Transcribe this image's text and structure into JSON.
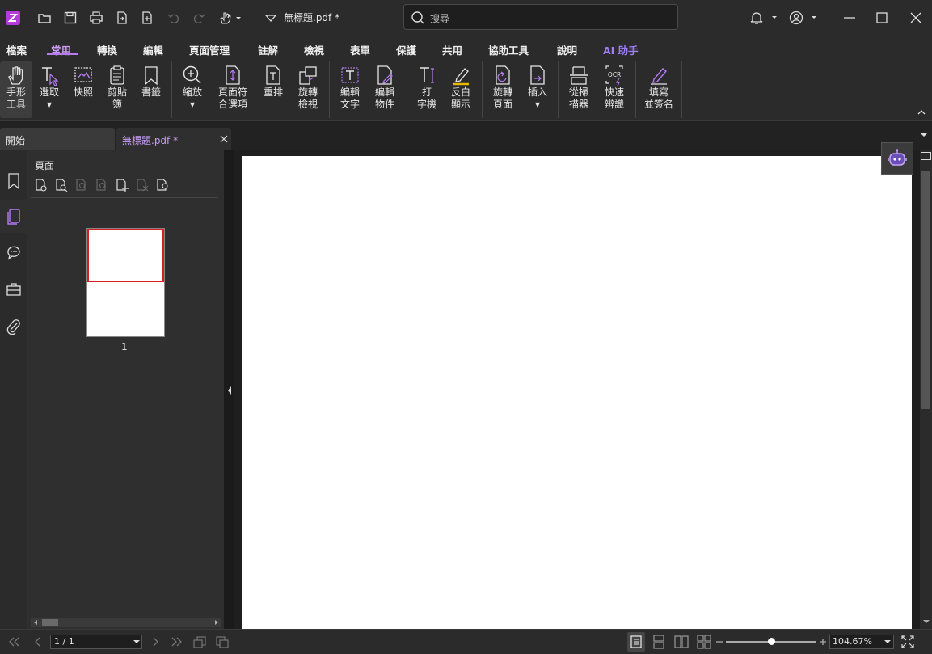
{
  "titlebar": {
    "doc_title": "無標題.pdf *",
    "search_placeholder": "搜尋"
  },
  "menu": {
    "items": [
      "檔案",
      "常用",
      "轉換",
      "編輯",
      "頁面管理",
      "註解",
      "檢視",
      "表單",
      "保護",
      "共用",
      "協助工具",
      "說明",
      "AI 助手"
    ],
    "active": "常用"
  },
  "ribbon": {
    "hand_tool": [
      "手形",
      "工具"
    ],
    "select": [
      "選取"
    ],
    "snapshot": [
      "快照"
    ],
    "clipboard": [
      "剪貼",
      "簿"
    ],
    "bookmark": [
      "書籤"
    ],
    "zoom": [
      "縮放"
    ],
    "fit_page": [
      "頁面符",
      "合選項"
    ],
    "reflow": [
      "重排"
    ],
    "rotate_view": [
      "旋轉",
      "檢視"
    ],
    "edit_text": [
      "編輯",
      "文字"
    ],
    "edit_object": [
      "編輯",
      "物件"
    ],
    "typewriter": [
      "打",
      "字機"
    ],
    "highlight": [
      "反白",
      "顯示"
    ],
    "rotate_page": [
      "旋轉",
      "頁面"
    ],
    "insert": [
      "插入"
    ],
    "scan": [
      "從掃",
      "描器"
    ],
    "ocr": [
      "快速",
      "辨識"
    ],
    "fill_sign": [
      "填寫",
      "並簽名"
    ]
  },
  "tabs": {
    "start": "開始",
    "doc": "無標題.pdf *"
  },
  "panel": {
    "title": "頁面",
    "thumb_page_number": "1"
  },
  "statusbar": {
    "page_value": "1 / 1",
    "zoom_value": "104.67%"
  },
  "colors": {
    "accent": "#b57cf0",
    "selection": "#d81e1e"
  }
}
